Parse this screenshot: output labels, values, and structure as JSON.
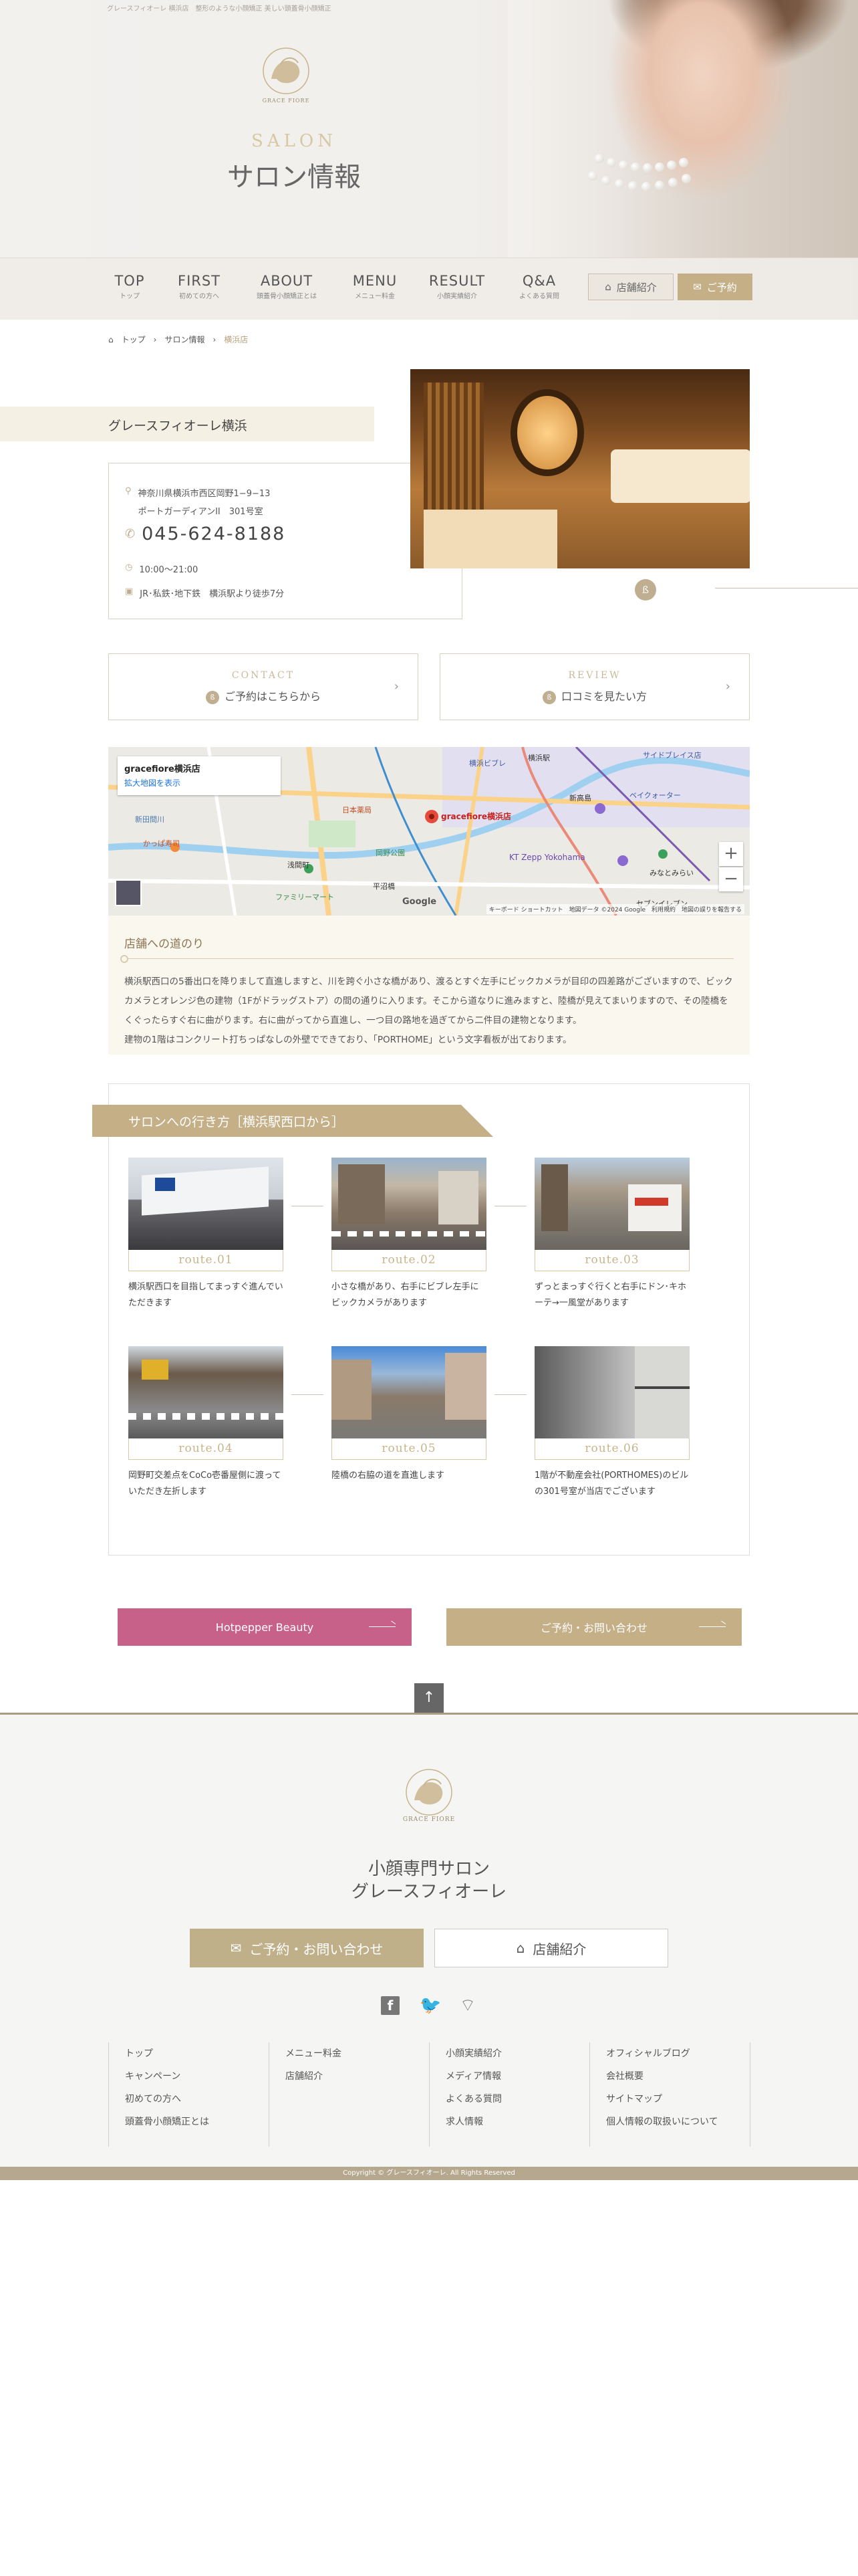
{
  "header": {
    "tagline": "グレースフィオーレ 横浜店　整形のような小顔矯正 美しい頭蓋骨小顔矯正",
    "logo_text": "GRACE FIORE",
    "page_title_en": "SALON",
    "page_title_ja": "サロン情報"
  },
  "nav": {
    "items": [
      {
        "en": "TOP",
        "ja": "トップ"
      },
      {
        "en": "FIRST",
        "ja": "初めての方へ"
      },
      {
        "en": "ABOUT",
        "ja": "頭蓋骨小顔矯正とは"
      },
      {
        "en": "MENU",
        "ja": "メニュー料金"
      },
      {
        "en": "RESULT",
        "ja": "小顔実績紹介"
      },
      {
        "en": "Q&A",
        "ja": "よくある質問"
      }
    ],
    "shop_label": "店舗紹介",
    "reserve_label": "ご予約"
  },
  "breadcrumb": {
    "home": "トップ",
    "parent": "サロン情報",
    "current": "横浜店"
  },
  "salon": {
    "name": "グレースフィオーレ横浜",
    "address1": "神奈川県横浜市西区岡野1−9−13",
    "address2": "ポートガーディアンII　301号室",
    "phone": "045-624-8188",
    "hours": "10:00〜21:00",
    "access": "JR･私鉄･地下鉄　横浜駅より徒歩7分"
  },
  "contact_boxes": [
    {
      "en": "CONTACT",
      "ja": "ご予約はこちらから"
    },
    {
      "en": "REVIEW",
      "ja": "口コミを見たい方"
    }
  ],
  "map": {
    "place_name": "gracefiore横浜店",
    "enlarge_link": "拡大地図を表示",
    "marker_label": "gracefiore横浜店",
    "footer": "キーボード ショートカット　地図データ ©2024 Google　利用規約　地図の誤りを報告する",
    "labels": [
      "横浜ビブレ",
      "横浜駅",
      "サイドブレイス店",
      "ベイクォーター",
      "新高島",
      "KT Zepp Yokohama",
      "みなとみらい",
      "セブンイレブン",
      "岡野公園",
      "浅間町",
      "かっぱ寿司",
      "日本薬局",
      "ファミリーマート",
      "平沼橋",
      "新田間川",
      "Google"
    ]
  },
  "directions": {
    "title": "店舗への道のり",
    "text1": "横浜駅西口の5番出口を降りまして直進しますと、川を跨ぐ小さな橋があり、渡るとすぐ左手にビックカメラが目印の四差路がございますので、ビックカメラとオレンジ色の建物（1Fがドラッグストア）の間の通りに入ります。そこから道なりに進みますと、陸橋が見えてまいりますので、その陸橋をくぐったらすぐ右に曲がります。右に曲がってから直進し、一つ目の路地を過ぎてから二件目の建物となります。",
    "text2": "建物の1階はコンクリート打ちっぱなしの外壁でできており、「PORTHOME」という文字看板が出ております。"
  },
  "route": {
    "title": "サロンへの行き方［横浜駅西口から］",
    "steps": [
      {
        "label": "route.01",
        "caption": "横浜駅西口を目指してまっすぐ進んでいただきます"
      },
      {
        "label": "route.02",
        "caption": "小さな橋があり、右手にビブレ左手にビックカメラがあります"
      },
      {
        "label": "route.03",
        "caption": "ずっとまっすぐ行くと右手にドン･キホーテ→一風堂があります"
      },
      {
        "label": "route.04",
        "caption": "岡野町交差点をCoCo壱番屋側に渡っていただき左折します"
      },
      {
        "label": "route.05",
        "caption": "陸橋の右脇の道を直進します"
      },
      {
        "label": "route.06",
        "caption": "1階が不動産会社(PORTHOMES)のビルの301号室が当店でございます"
      }
    ]
  },
  "cta": {
    "hotpepper": "Hotpepper Beauty",
    "contact": "ご予約・お問い合わせ"
  },
  "footer": {
    "logo_text": "GRACE FIORE",
    "title1": "小顔専門サロン",
    "title2": "グレースフィオーレ",
    "btn_contact": "ご予約・お問い合わせ",
    "btn_shop": "店舗紹介",
    "columns": [
      [
        "トップ",
        "キャンペーン",
        "初めての方へ",
        "頭蓋骨小顔矯正とは"
      ],
      [
        "メニュー料金",
        "店舗紹介"
      ],
      [
        "小顔実績紹介",
        "メディア情報",
        "よくある質問",
        "求人情報"
      ],
      [
        "オフィシャルブログ",
        "会社概要",
        "サイトマップ",
        "個人情報の取扱いについて"
      ]
    ],
    "copyright": "Copyright © グレースフィオーレ. All Rights Reserved"
  }
}
